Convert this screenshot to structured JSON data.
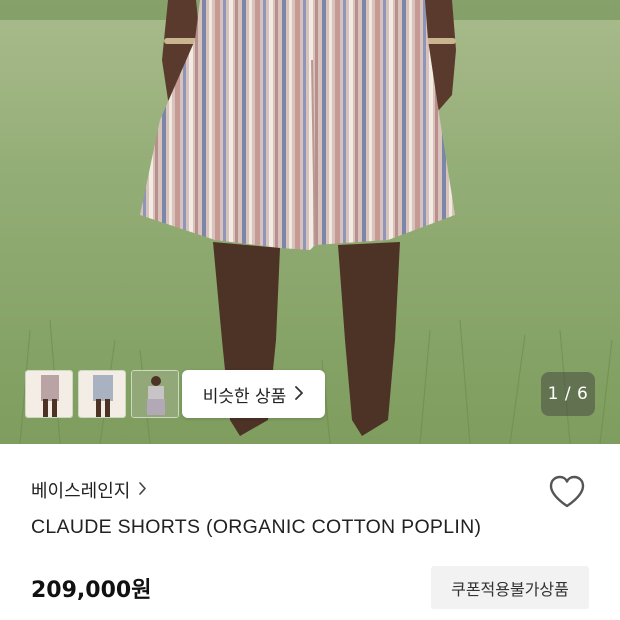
{
  "gallery": {
    "similar_label": "비슷한 상품",
    "counter": "1 / 6",
    "thumbnails": [
      "thumbnail-1",
      "thumbnail-2",
      "thumbnail-3"
    ]
  },
  "product": {
    "brand": "베이스레인지",
    "name": "CLAUDE SHORTS (ORGANIC COTTON POPLIN)",
    "price": "209,000원",
    "coupon_badge": "쿠폰적용불가상품"
  },
  "icons": {
    "brand_chevron": "chevron-right-icon",
    "similar_chevron": "chevron-right-icon",
    "wishlist": "heart-outline-icon"
  }
}
